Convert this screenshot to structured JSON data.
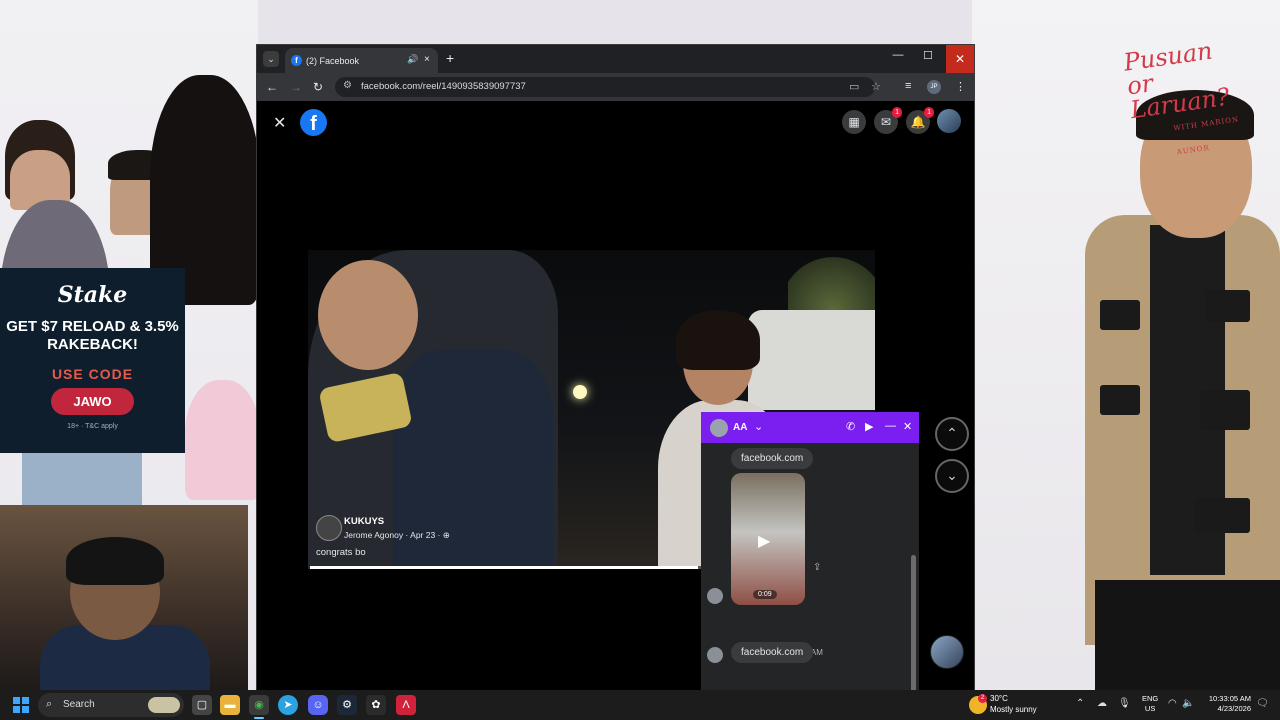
{
  "browser": {
    "tab_title": "(2) Facebook",
    "tab_audio_icon": "🔊",
    "tab_close": "×",
    "new_tab": "+",
    "url": "facebook.com/reel/1490935839097737",
    "profile_initials": "JP",
    "minimize": "—",
    "maximize": "☐",
    "close": "✕"
  },
  "facebook": {
    "logo": "f",
    "messenger_badge": "1",
    "notifications_badge": "1"
  },
  "reel": {
    "author": "KUKUYS",
    "poster": "Jerome Agonoy · Apr 23 · ⊕",
    "caption": "congrats bo",
    "progress_fraction": 0.69
  },
  "chat": {
    "contact": "AA",
    "link1": "facebook.com",
    "video_duration": "0:09",
    "timestamp": "10:33 AM",
    "link2": "facebook.com"
  },
  "stream_overlay": {
    "stake_logo": "Stake",
    "stake_headline": "GET $7 RELOAD & 3.5% RAKEBACK!",
    "stake_use_code": "USE CODE",
    "stake_code": "JAWO",
    "stake_fine": "18+ · T&C apply",
    "show_title": "Pusuan or Laruan?",
    "show_subtitle": "WITH MARION AUNOR"
  },
  "taskbar": {
    "search_label": "Search",
    "weather_temp": "30°C",
    "weather_desc": "Mostly sunny",
    "lang_1": "ENG",
    "lang_2": "US",
    "time": "10:33:05 AM",
    "date": "4/23/2026"
  }
}
